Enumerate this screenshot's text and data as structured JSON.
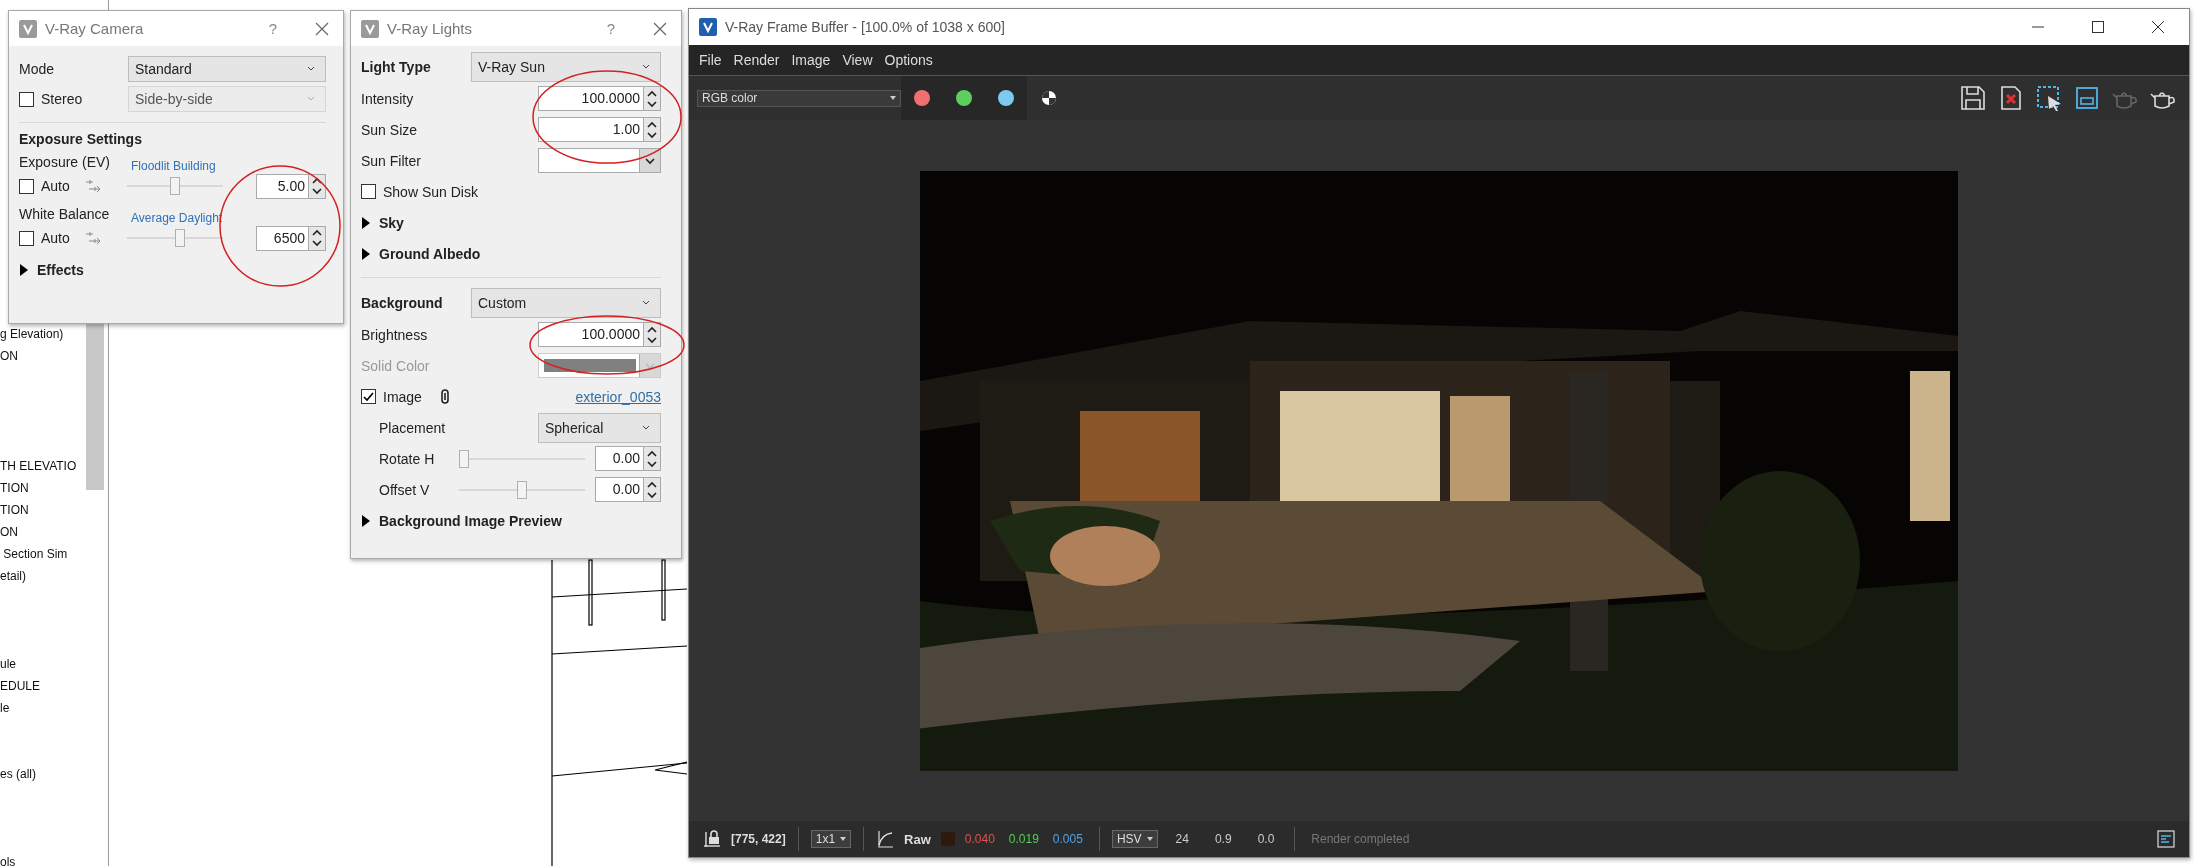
{
  "project_browser": {
    "groups": [
      [
        "g Elevation)",
        "ON"
      ],
      [
        "TH ELEVATIO",
        "TION",
        "TION",
        "ON",
        " Section Sim",
        "etail)"
      ],
      [
        "ule",
        "EDULE",
        "le"
      ],
      [
        "es (all)"
      ],
      [
        "ols"
      ]
    ]
  },
  "camera": {
    "title": "V-Ray Camera",
    "help": "?",
    "mode_label": "Mode",
    "mode": "Standard",
    "stereo": {
      "label": "Stereo",
      "checked": false
    },
    "stereo_mode": {
      "value": "Side-by-side",
      "disabled": true
    },
    "section": "Exposure Settings",
    "settings": [
      {
        "label": "Exposure (EV)",
        "auto": {
          "label": "Auto",
          "checked": false
        },
        "preset": "Floodlit Building",
        "level": 0.5,
        "value": "5.00"
      },
      {
        "label": "White Balance",
        "auto": {
          "label": "Auto",
          "checked": false
        },
        "preset": "Average Daylight",
        "level": 0.56,
        "value": "6500"
      }
    ],
    "effects": {
      "label": "Effects",
      "expanded": false
    }
  },
  "lights": {
    "title": "V-Ray Lights",
    "help": "?",
    "rows": [
      {
        "kind": "header",
        "label": "Light Type",
        "value": "V-Ray Sun"
      },
      {
        "kind": "spinner",
        "label": "Intensity",
        "value": "100.0000"
      },
      {
        "kind": "spinner",
        "label": "Sun Size",
        "value": "1.00"
      },
      {
        "kind": "combo",
        "label": "Sun Filter"
      },
      {
        "kind": "checkbox",
        "label": "Show Sun Disk",
        "checked": false
      },
      {
        "kind": "section",
        "label": "Sky",
        "expanded": false
      },
      {
        "kind": "section",
        "label": "Ground Albedo",
        "expanded": false
      },
      {
        "kind": "header",
        "label": "Background",
        "value": "Custom"
      },
      {
        "kind": "spinner",
        "label": "Brightness",
        "value": "100.0000"
      },
      {
        "kind": "color",
        "label": "Solid Color",
        "disabled": true
      },
      {
        "label": "Image",
        "checked": true,
        "link": "exterior_0053"
      },
      {
        "kind": "dropdown",
        "label": "Placement",
        "value": "Spherical"
      },
      {
        "kind": "slider",
        "label": "Rotate H",
        "level": 0,
        "value": "0.00"
      },
      {
        "kind": "slider",
        "label": "Offset V",
        "level": 0.5,
        "value": "0.00"
      },
      {
        "kind": "section",
        "label": "Background Image Preview",
        "expanded": false
      }
    ]
  },
  "frame_buffer": {
    "title": "V-Ray Frame Buffer - [100.0% of 1038 x 600]",
    "menu": [
      "File",
      "Render",
      "Image",
      "View",
      "Options"
    ],
    "channel": "RGB color",
    "channels": [
      {
        "color": "#f07070"
      },
      {
        "color": "#5ecf5e"
      },
      {
        "color": "#7ccaf2"
      }
    ],
    "render": {
      "kind": "picture"
    },
    "status": {
      "coords": "[775, 422]",
      "zoom": "1x1",
      "mode": "Raw",
      "values": [
        {
          "text": "0.040",
          "color": "#e05050"
        },
        {
          "text": "0.019",
          "color": "#50d050"
        },
        {
          "text": "0.005",
          "color": "#4fa3e6"
        }
      ],
      "color_space": "HSV",
      "hsv": [
        "24",
        "0.9",
        "0.0"
      ],
      "message": "Render completed"
    }
  }
}
